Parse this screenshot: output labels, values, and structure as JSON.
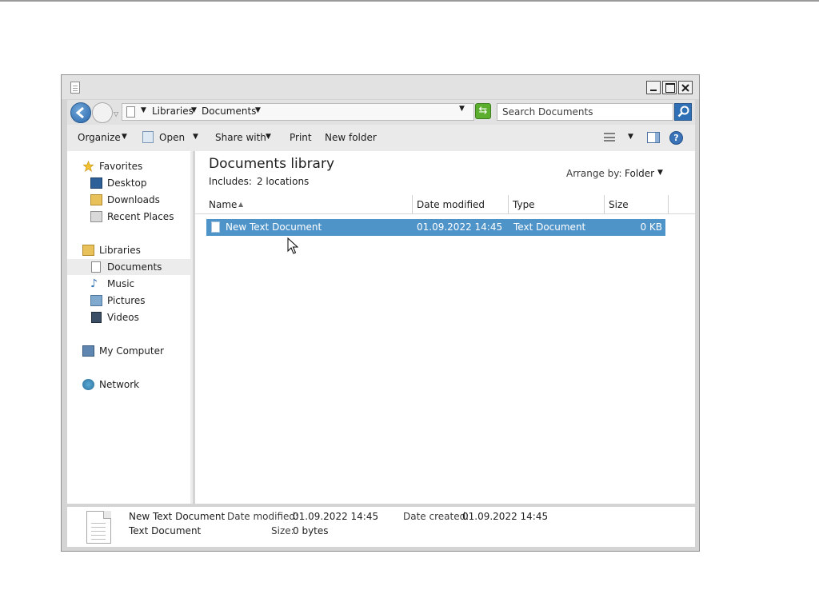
{
  "window": {
    "breadcrumb": [
      "Libraries",
      "Documents"
    ]
  },
  "search": {
    "placeholder": "Search Documents"
  },
  "toolbar": {
    "organize": "Organize",
    "open": "Open",
    "share_with": "Share with",
    "print": "Print",
    "new_folder": "New folder"
  },
  "sidebar": {
    "favorites": {
      "label": "Favorites",
      "items": [
        "Desktop",
        "Downloads",
        "Recent Places"
      ]
    },
    "libraries": {
      "label": "Libraries",
      "items": [
        "Documents",
        "Music",
        "Pictures",
        "Videos"
      ]
    },
    "computer": "My Computer",
    "network": "Network",
    "selected": "Documents"
  },
  "library": {
    "title": "Documents library",
    "includes_label": "Includes:",
    "includes_value": "2 locations",
    "arrange_label": "Arrange by:",
    "arrange_value": "Folder"
  },
  "columns": [
    "Name",
    "Date modified",
    "Type",
    "Size"
  ],
  "files": [
    {
      "name": "New Text Document",
      "date_modified": "01.09.2022 14:45",
      "type": "Text Document",
      "size": "0 KB",
      "selected": true
    }
  ],
  "details": {
    "name": "New Text Document",
    "type": "Text Document",
    "date_modified_label": "Date modified:",
    "date_modified": "01.09.2022 14:45",
    "size_label": "Size:",
    "size": "0 bytes",
    "date_created_label": "Date created:",
    "date_created": "01.09.2022 14:45"
  },
  "colors": {
    "selection": "#4f94c9",
    "nav_selected": "#ececec",
    "chrome": "#e2e2e2"
  }
}
